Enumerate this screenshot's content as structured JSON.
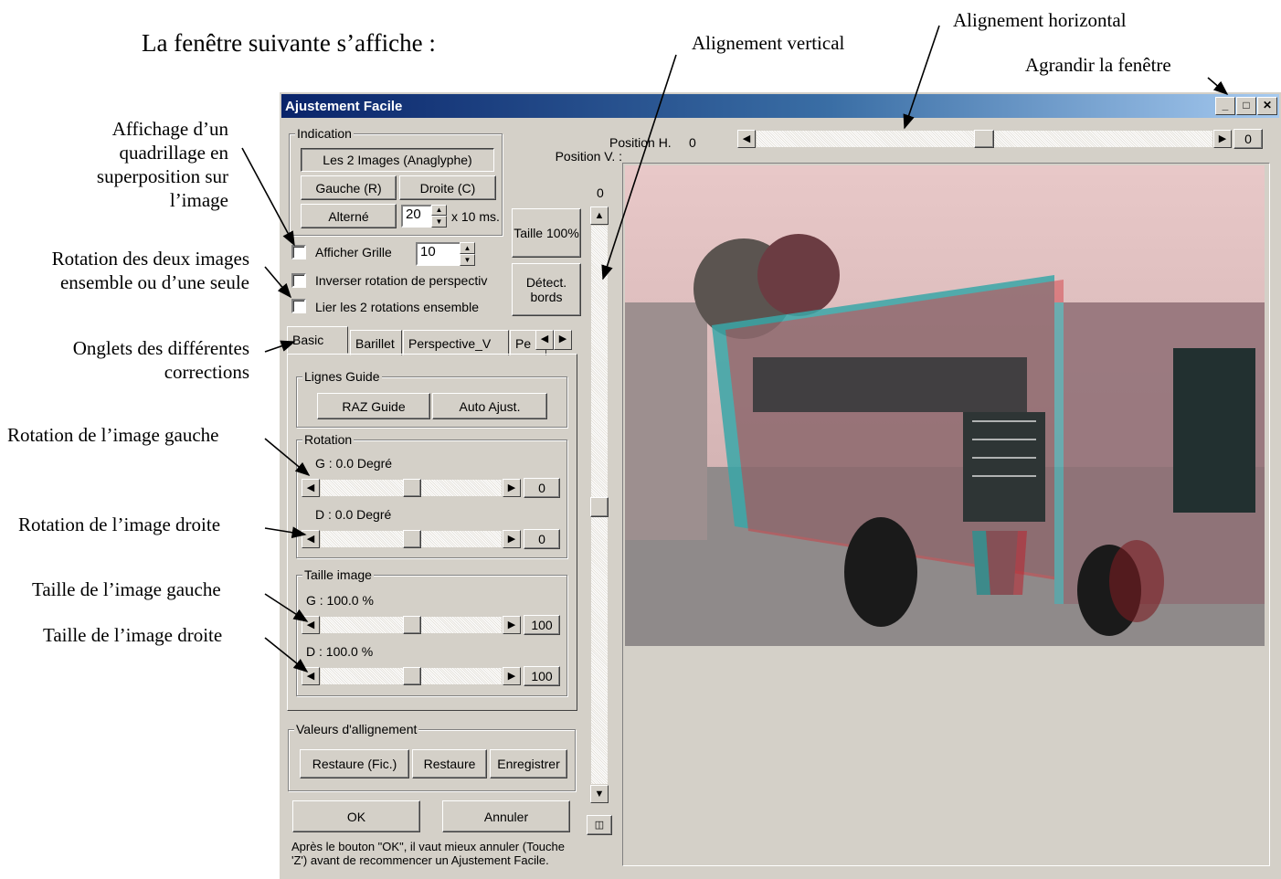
{
  "intro": "La fenêtre suivante s’affiche :",
  "annotations": {
    "grid": "Affichage d’un quadrillage en superposition sur l’image",
    "rotation_both": "Rotation des deux images ensemble ou d’une seule",
    "tabs": "Onglets des différentes corrections",
    "rot_left": "Rotation de l’image gauche",
    "rot_right": "Rotation de l’image droite",
    "size_left": "Taille de l’image gauche",
    "size_right": "Taille de l’image droite",
    "v_align": "Alignement vertical",
    "h_align": "Alignement horizontal",
    "maximize": "Agrandir la fenêtre"
  },
  "window": {
    "title": "Ajustement Facile",
    "minimize": "_",
    "maximize": "□",
    "close": "✕"
  },
  "indication": {
    "label": "Indication",
    "anaglyph": "Les 2 Images (Anaglyphe)",
    "left": "Gauche (R)",
    "right": "Droite (C)",
    "alternate": "Alterné",
    "interval": "20",
    "interval_unit": "x 10 ms."
  },
  "side_buttons": {
    "size100": "Taille 100%",
    "detect": "Détect. bords"
  },
  "options": {
    "show_grid": "Afficher Grille",
    "grid_value": "10",
    "invert_rotation": "Inverser rotation de perspectiv",
    "link_rotations": "Lier les 2 rotations ensemble"
  },
  "tabs": [
    "Basic",
    "Barillet",
    "Perspective_V",
    "Pe"
  ],
  "guides": {
    "label": "Lignes Guide",
    "raz": "RAZ Guide",
    "auto": "Auto Ajust."
  },
  "rotation": {
    "label": "Rotation",
    "g_label": "G : 0.0 Degré",
    "g_value": "0",
    "d_label": "D : 0.0 Degré",
    "d_value": "0"
  },
  "size": {
    "label": "Taille image",
    "g_label": "G : 100.0 %",
    "g_value": "100",
    "d_label": "D : 100.0 %",
    "d_value": "100"
  },
  "alignment_values": {
    "label": "Valeurs d'allignement",
    "restore_file": "Restaure (Fic.)",
    "restore": "Restaure",
    "save": "Enregistrer"
  },
  "ok": "OK",
  "cancel": "Annuler",
  "note": "Après le bouton \"OK\", il vaut mieux annuler (Touche 'Z') avant de recommencer un Ajustement Facile.",
  "position_h_label": "Position H.",
  "position_h_value": "0",
  "position_h_box": "0",
  "position_v_label": "Position V. :",
  "position_v_value": "0",
  "theme": {
    "titlebar_start": "#0a246a",
    "titlebar_end": "#a6caf0",
    "face": "#d4d0c8"
  }
}
